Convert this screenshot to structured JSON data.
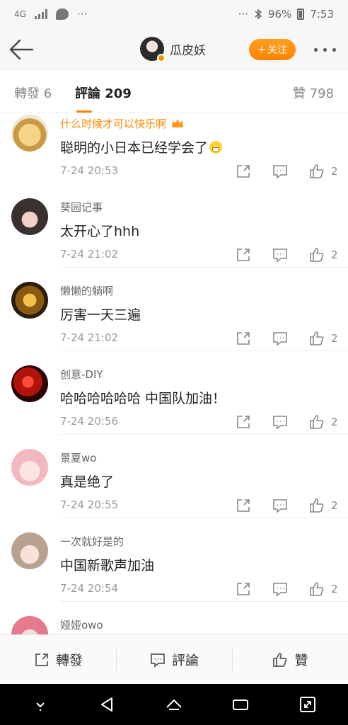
{
  "status_bar": {
    "network": "4G",
    "dots_left": "···",
    "dots_right": "···",
    "battery": "96%",
    "time": "7:53"
  },
  "header": {
    "user_name": "瓜皮妖",
    "follow_label": "关注",
    "follow_plus": "+"
  },
  "tabs": {
    "repost": {
      "label": "轉發",
      "count": "6"
    },
    "comments": {
      "label": "評論",
      "count": "209"
    },
    "likes": {
      "label": "贊",
      "count": "798"
    }
  },
  "comments": [
    {
      "name": "什么时候才可以快乐啊",
      "text": "聪明的小日本已经学会了",
      "time": "7-24 20:53",
      "likes": "2"
    },
    {
      "name": "葵园记事",
      "text": "太开心了hhh",
      "time": "7-24 21:02",
      "likes": "2"
    },
    {
      "name": "懒懒的躺啊",
      "text": "厉害一天三遍",
      "time": "7-24 21:02",
      "likes": "2"
    },
    {
      "name": "创意-DIY",
      "text": "哈哈哈哈哈哈 中国队加油！",
      "time": "7-24 20:56",
      "likes": "2"
    },
    {
      "name": "景夏wo",
      "text": "真是绝了",
      "time": "7-24 20:55",
      "likes": "2"
    },
    {
      "name": "一次就好是的",
      "text": "中国新歌声加油",
      "time": "7-24 20:54",
      "likes": "2"
    },
    {
      "name": "娅娅owo",
      "text": "",
      "time": "",
      "likes": ""
    }
  ],
  "bottom_bar": {
    "repost": "轉發",
    "comment": "評論",
    "like": "贊"
  },
  "colors": {
    "accent": "#ff8200",
    "header_bg": "#f7f7f7"
  }
}
